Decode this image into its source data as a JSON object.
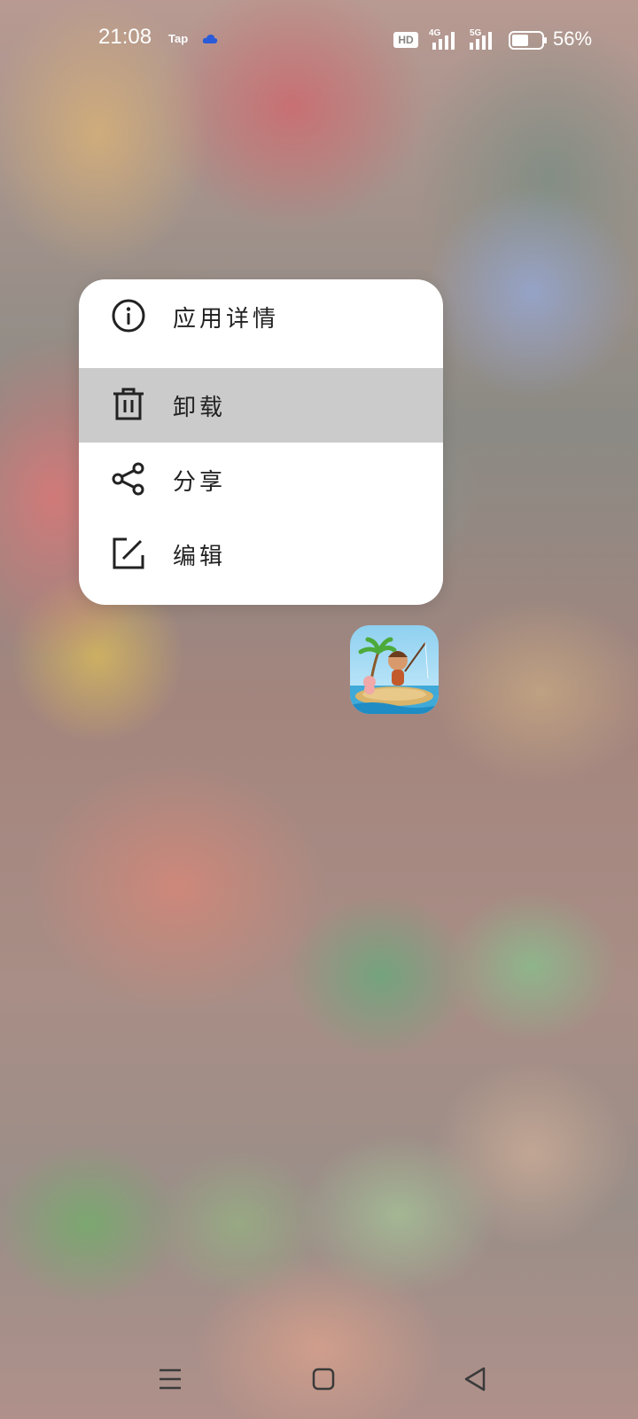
{
  "status_bar": {
    "time": "21:08",
    "notification_app": "Tap",
    "hd_badge": "HD",
    "network_1": "4G",
    "network_2": "5G",
    "battery": "56%",
    "icons": [
      "cloud-icon",
      "hd-icon",
      "signal-4g-icon",
      "signal-5g-icon",
      "battery-icon"
    ]
  },
  "context_menu": {
    "items": [
      {
        "label": "应用详情",
        "icon": "info-icon",
        "selected": false
      },
      {
        "label": "卸载",
        "icon": "trash-icon",
        "selected": true
      },
      {
        "label": "分享",
        "icon": "share-icon",
        "selected": false
      },
      {
        "label": "编辑",
        "icon": "edit-icon",
        "selected": false
      }
    ]
  },
  "app": {
    "icon": "island-game-app-icon"
  },
  "nav_bar": {
    "icons": [
      "menu-icon",
      "home-icon",
      "back-icon"
    ]
  },
  "colors": {
    "menu_bg": "#ffffff",
    "selected_bg": "#cbcbcb",
    "text": "#222222"
  }
}
